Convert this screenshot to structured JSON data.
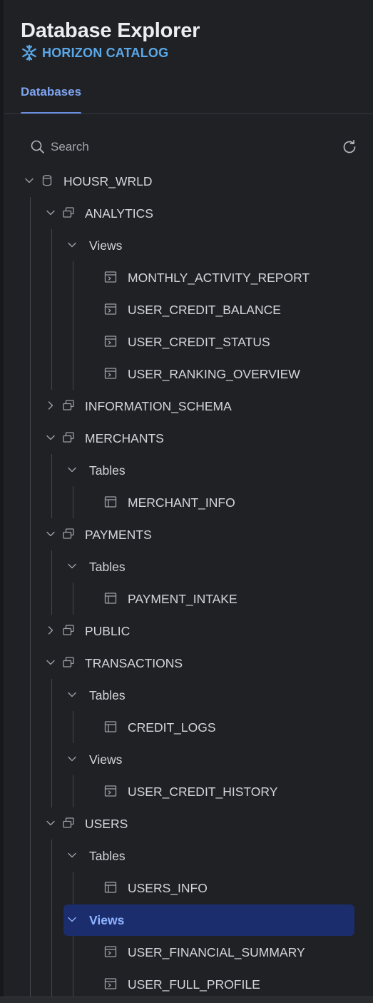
{
  "app": {
    "title": "Database Explorer",
    "brand": "HORIZON CATALOG"
  },
  "tabs": [
    {
      "label": "Databases",
      "active": true
    }
  ],
  "search": {
    "placeholder": "Search"
  },
  "colors": {
    "accent": "#7fa4f0",
    "brand": "#5aa8e8",
    "selection": "#1c2d6e",
    "background": "#1f2125"
  },
  "tree": [
    {
      "label": "HOUSR_WRLD",
      "kind": "database",
      "expanded": true,
      "depth": 0
    },
    {
      "label": "ANALYTICS",
      "kind": "schema",
      "expanded": true,
      "depth": 1
    },
    {
      "label": "Views",
      "kind": "folder",
      "expanded": true,
      "depth": 2
    },
    {
      "label": "MONTHLY_ACTIVITY_REPORT",
      "kind": "view",
      "depth": 3
    },
    {
      "label": "USER_CREDIT_BALANCE",
      "kind": "view",
      "depth": 3
    },
    {
      "label": "USER_CREDIT_STATUS",
      "kind": "view",
      "depth": 3
    },
    {
      "label": "USER_RANKING_OVERVIEW",
      "kind": "view",
      "depth": 3
    },
    {
      "label": "INFORMATION_SCHEMA",
      "kind": "schema",
      "expanded": false,
      "depth": 1
    },
    {
      "label": "MERCHANTS",
      "kind": "schema",
      "expanded": true,
      "depth": 1
    },
    {
      "label": "Tables",
      "kind": "folder",
      "expanded": true,
      "depth": 2
    },
    {
      "label": "MERCHANT_INFO",
      "kind": "table",
      "depth": 3
    },
    {
      "label": "PAYMENTS",
      "kind": "schema",
      "expanded": true,
      "depth": 1
    },
    {
      "label": "Tables",
      "kind": "folder",
      "expanded": true,
      "depth": 2
    },
    {
      "label": "PAYMENT_INTAKE",
      "kind": "table",
      "depth": 3
    },
    {
      "label": "PUBLIC",
      "kind": "schema",
      "expanded": false,
      "depth": 1
    },
    {
      "label": "TRANSACTIONS",
      "kind": "schema",
      "expanded": true,
      "depth": 1
    },
    {
      "label": "Tables",
      "kind": "folder",
      "expanded": true,
      "depth": 2
    },
    {
      "label": "CREDIT_LOGS",
      "kind": "table",
      "depth": 3
    },
    {
      "label": "Views",
      "kind": "folder",
      "expanded": true,
      "depth": 2
    },
    {
      "label": "USER_CREDIT_HISTORY",
      "kind": "view",
      "depth": 3
    },
    {
      "label": "USERS",
      "kind": "schema",
      "expanded": true,
      "depth": 1
    },
    {
      "label": "Tables",
      "kind": "folder",
      "expanded": true,
      "depth": 2
    },
    {
      "label": "USERS_INFO",
      "kind": "table",
      "depth": 3
    },
    {
      "label": "Views",
      "kind": "folder",
      "expanded": true,
      "depth": 2,
      "selected": true
    },
    {
      "label": "USER_FINANCIAL_SUMMARY",
      "kind": "view",
      "depth": 3
    },
    {
      "label": "USER_FULL_PROFILE",
      "kind": "view",
      "depth": 3
    }
  ]
}
